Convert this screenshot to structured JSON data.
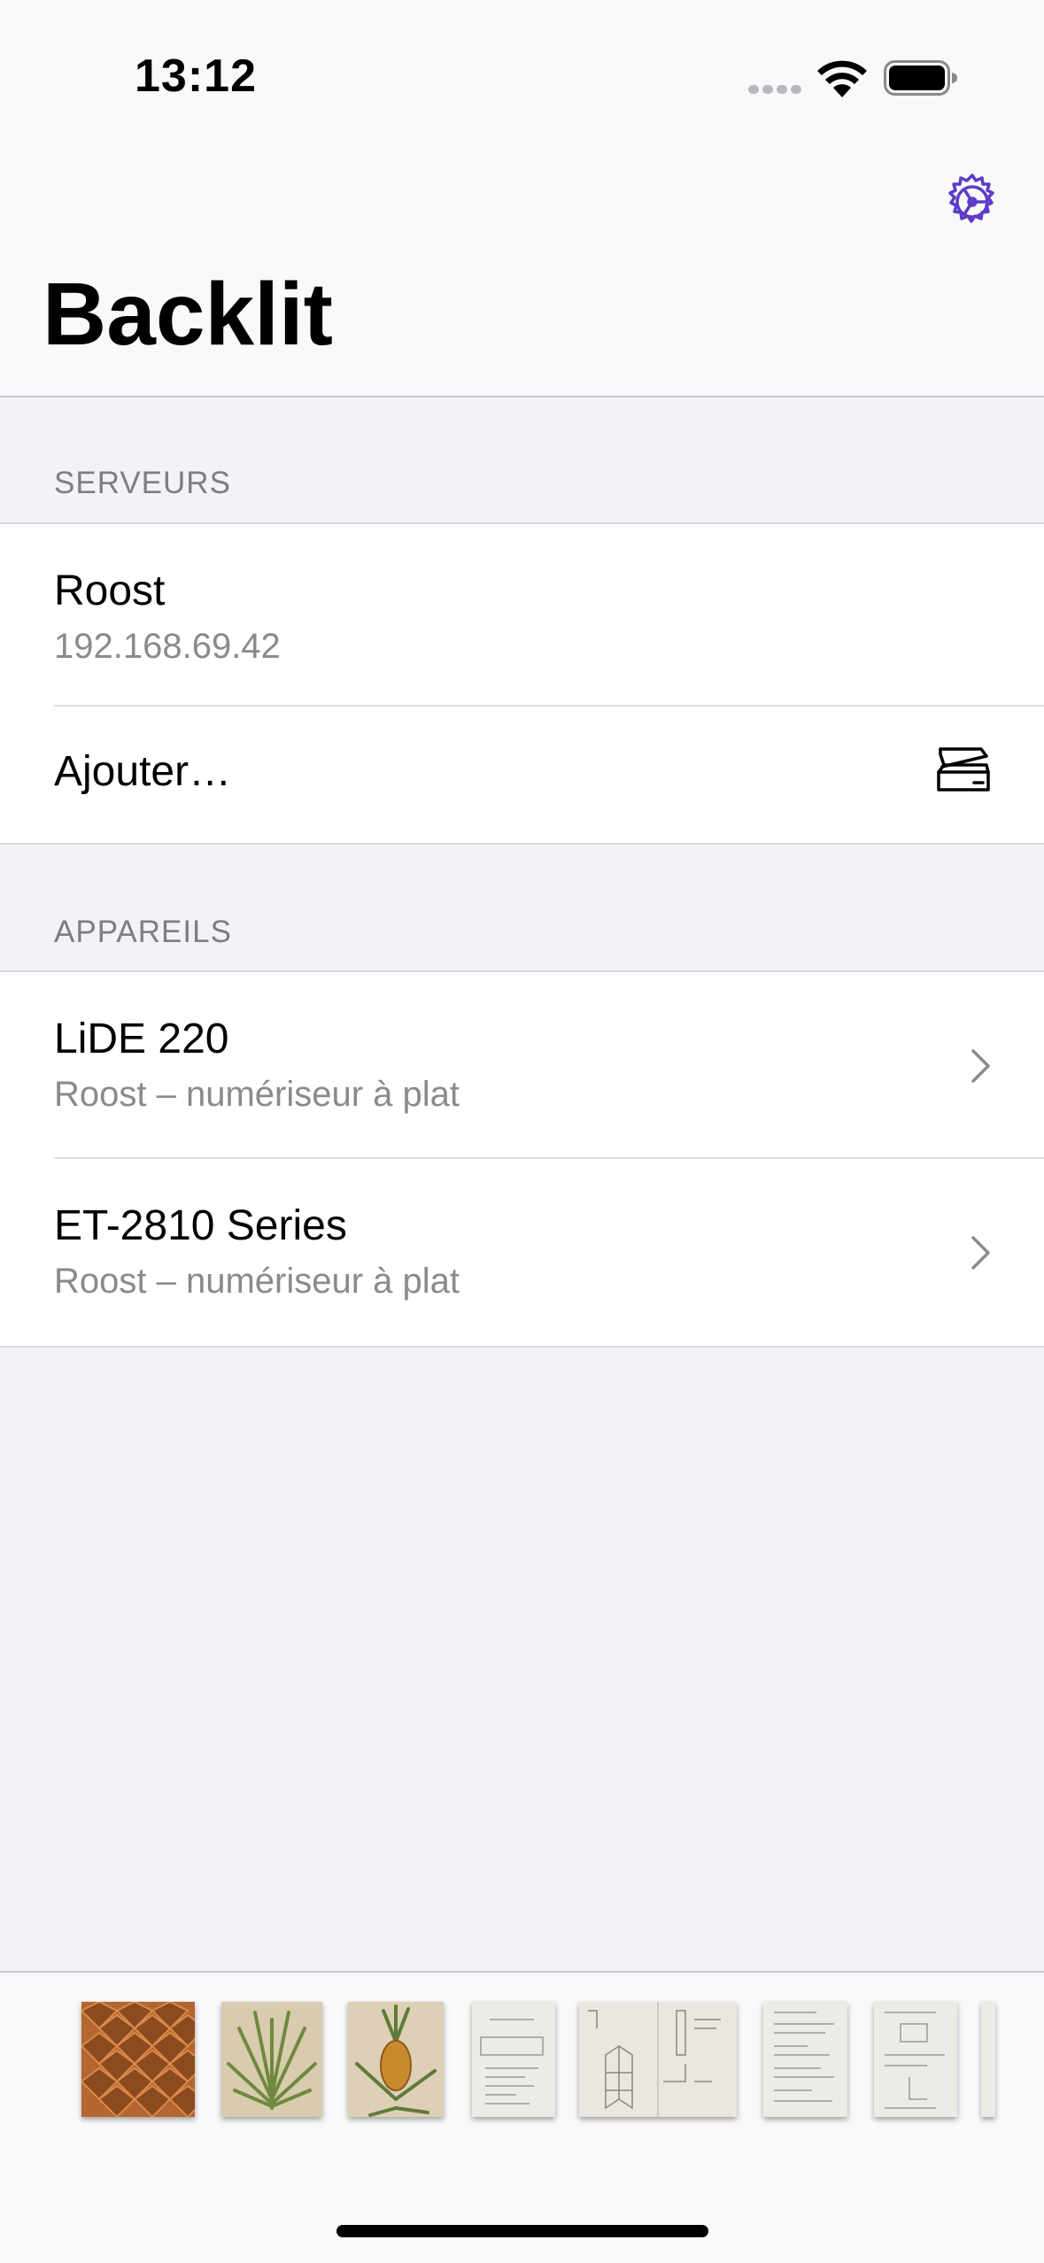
{
  "status_bar": {
    "time": "13:12"
  },
  "nav": {
    "title": "Backlit",
    "settings_icon": "gear-icon",
    "accent_color": "#5e3bc9"
  },
  "sections": {
    "servers": {
      "header": "SERVEURS",
      "items": [
        {
          "title": "Roost",
          "subtitle": "192.168.69.42"
        }
      ],
      "add_label": "Ajouter…",
      "add_icon": "scanner-icon"
    },
    "devices": {
      "header": "APPAREILS",
      "items": [
        {
          "title": "LiDE 220",
          "subtitle": "Roost – numériseur à plat"
        },
        {
          "title": "ET-2810 Series",
          "subtitle": "Roost – numériseur à plat"
        }
      ]
    }
  },
  "thumbnails": [
    {
      "name": "pineapple-skin-scan"
    },
    {
      "name": "pineapple-leaves-scan"
    },
    {
      "name": "pineapple-plant-scan"
    },
    {
      "name": "sketch-page-scan"
    },
    {
      "name": "sketch-spread-scan"
    },
    {
      "name": "notes-page-scan"
    },
    {
      "name": "notes-page-scan-2"
    },
    {
      "name": "partial-page-scan"
    }
  ]
}
